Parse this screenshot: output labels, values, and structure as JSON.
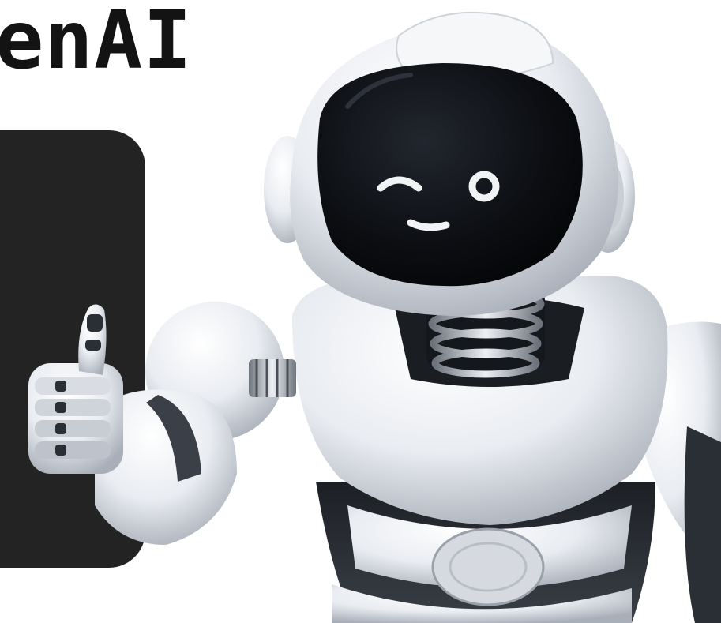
{
  "headline": {
    "text": "enAI"
  },
  "illustration": {
    "subject": "white-robot-winking-thumbs-up",
    "face_color": "#0b0d11",
    "body_color": "#eef0f4",
    "card_color": "#232323"
  }
}
